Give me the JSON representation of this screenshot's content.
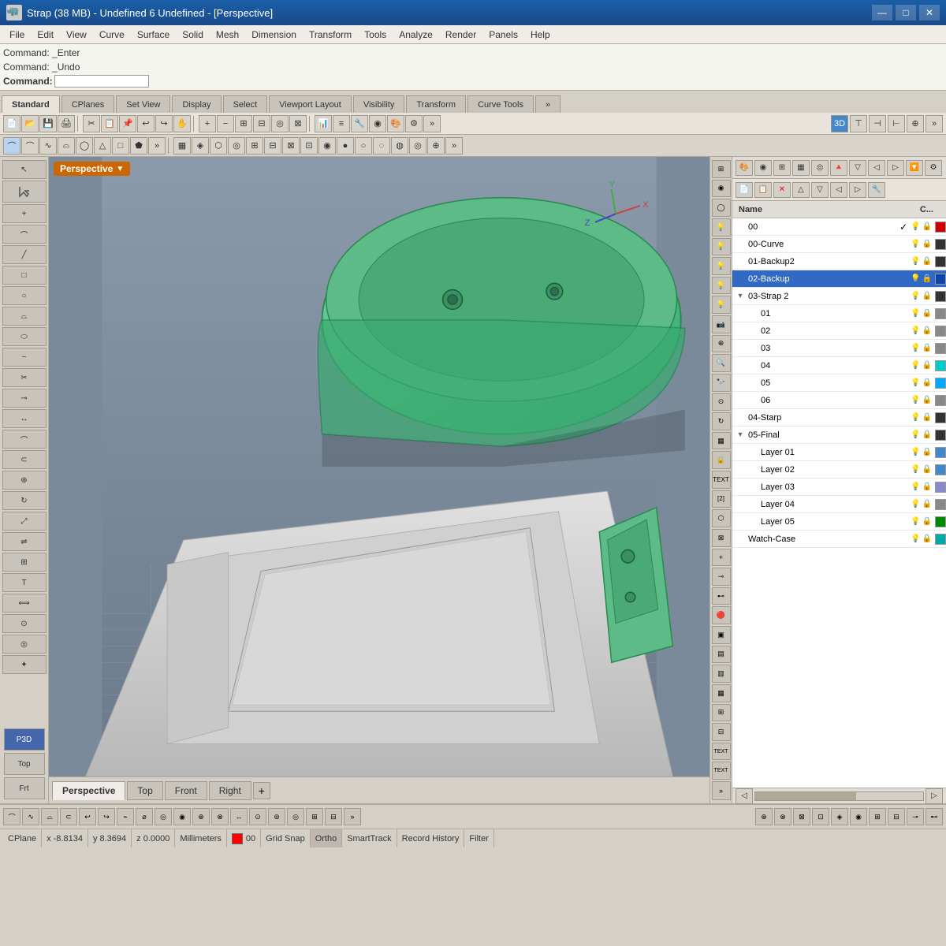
{
  "titlebar": {
    "title": "Strap (38 MB) - Undefined 6 Undefined - [Perspective]",
    "icon": "rhino-icon",
    "minimize": "—",
    "maximize": "□",
    "close": "✕"
  },
  "menubar": {
    "items": [
      "File",
      "Edit",
      "View",
      "Curve",
      "Surface",
      "Solid",
      "Mesh",
      "Dimension",
      "Transform",
      "Tools",
      "Analyze",
      "Render",
      "Panels",
      "Help"
    ]
  },
  "command": {
    "line1": "Command: _Enter",
    "line2": "Command: _Undo",
    "label": "Command:"
  },
  "toolbars": {
    "tabs": [
      "Standard",
      "CPlanes",
      "Set View",
      "Display",
      "Select",
      "Viewport Layout",
      "Visibility",
      "Transform",
      "Curve Tools"
    ],
    "active_tab": "Curve Tools"
  },
  "viewport": {
    "label": "Perspective",
    "tabs": [
      "Perspective",
      "Top",
      "Front",
      "Right"
    ],
    "active_tab": "Perspective"
  },
  "statusbar": {
    "cplane": "CPlane",
    "x": "x -8.8134",
    "y": "y 8.3694",
    "z": "z 0.0000",
    "units": "Millimeters",
    "layer": "00",
    "grid_snap": "Grid Snap",
    "ortho": "Ortho",
    "smart_track": "SmartTrack",
    "record_history": "Record History",
    "filter": "Filter"
  },
  "layers": {
    "header_name": "Name",
    "header_c": "C...",
    "items": [
      {
        "id": "00",
        "name": "00",
        "check": "✓",
        "indent": 0,
        "color": "#cc0000",
        "selected": false
      },
      {
        "id": "00-curve",
        "name": "00-Curve",
        "check": "",
        "indent": 0,
        "color": "#333333",
        "selected": false
      },
      {
        "id": "01-backup2",
        "name": "01-Backup2",
        "check": "",
        "indent": 0,
        "color": "#333333",
        "selected": false
      },
      {
        "id": "02-backup",
        "name": "02-Backup",
        "check": "",
        "indent": 0,
        "color": "#1144aa",
        "selected": true
      },
      {
        "id": "03-strap2",
        "name": "03-Strap 2",
        "check": "",
        "indent": 0,
        "color": "#333333",
        "selected": false,
        "expand": "▾"
      },
      {
        "id": "03-01",
        "name": "01",
        "check": "",
        "indent": 1,
        "color": "#888888",
        "selected": false
      },
      {
        "id": "03-02",
        "name": "02",
        "check": "",
        "indent": 1,
        "color": "#888888",
        "selected": false
      },
      {
        "id": "03-03",
        "name": "03",
        "check": "",
        "indent": 1,
        "color": "#888888",
        "selected": false
      },
      {
        "id": "03-04",
        "name": "04",
        "check": "",
        "indent": 1,
        "color": "#00cccc",
        "selected": false
      },
      {
        "id": "03-05",
        "name": "05",
        "check": "",
        "indent": 1,
        "color": "#00aaff",
        "selected": false
      },
      {
        "id": "03-06",
        "name": "06",
        "check": "",
        "indent": 1,
        "color": "#888888",
        "selected": false
      },
      {
        "id": "04-starp",
        "name": "04-Starp",
        "check": "",
        "indent": 0,
        "color": "#333333",
        "selected": false
      },
      {
        "id": "05-final",
        "name": "05-Final",
        "check": "",
        "indent": 0,
        "color": "#333333",
        "selected": false,
        "expand": "▾"
      },
      {
        "id": "layer01",
        "name": "Layer 01",
        "check": "",
        "indent": 1,
        "color": "#4488cc",
        "selected": false
      },
      {
        "id": "layer02",
        "name": "Layer 02",
        "check": "",
        "indent": 1,
        "color": "#4488cc",
        "selected": false
      },
      {
        "id": "layer03",
        "name": "Layer 03",
        "check": "",
        "indent": 1,
        "color": "#8888cc",
        "selected": false
      },
      {
        "id": "layer04",
        "name": "Layer 04",
        "check": "",
        "indent": 1,
        "color": "#888888",
        "selected": false
      },
      {
        "id": "layer05",
        "name": "Layer 05",
        "check": "",
        "indent": 1,
        "color": "#008800",
        "selected": false
      },
      {
        "id": "watch-case",
        "name": "Watch-Case",
        "check": "",
        "indent": 0,
        "color": "#00aaaa",
        "selected": false
      }
    ]
  },
  "bottom_tools": {
    "items": 20
  }
}
